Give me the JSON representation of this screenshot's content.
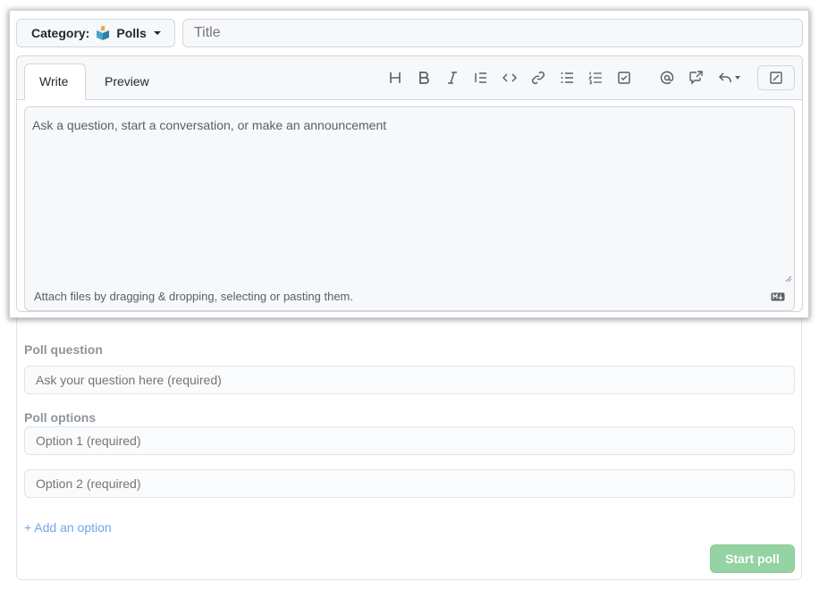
{
  "category": {
    "prefix": "Category:",
    "value": "Polls",
    "icon": "ballot-box-icon"
  },
  "title_input": {
    "placeholder": "Title"
  },
  "editor": {
    "tabs": [
      {
        "label": "Write",
        "active": true
      },
      {
        "label": "Preview",
        "active": false
      }
    ],
    "toolbar": [
      "heading-icon",
      "bold-icon",
      "italic-icon",
      "quote-icon",
      "code-icon",
      "link-icon",
      "bulleted-list-icon",
      "numbered-list-icon",
      "task-list-icon",
      "mention-icon",
      "cross-reference-icon",
      "saved-reply-icon",
      "fullscreen-icon"
    ],
    "body_placeholder": "Ask a question, start a conversation, or make an announcement",
    "attach_text": "Attach files by dragging & dropping, selecting or pasting them."
  },
  "poll": {
    "question_label": "Poll question",
    "question_placeholder": "Ask your question here (required)",
    "options_label": "Poll options",
    "option_placeholders": [
      "Option 1 (required)",
      "Option 2 (required)"
    ],
    "add_option": "+ Add an option",
    "submit": "Start poll"
  },
  "colors": {
    "accent_link": "#6fa6e8",
    "submit_bg": "#94d3a2"
  }
}
